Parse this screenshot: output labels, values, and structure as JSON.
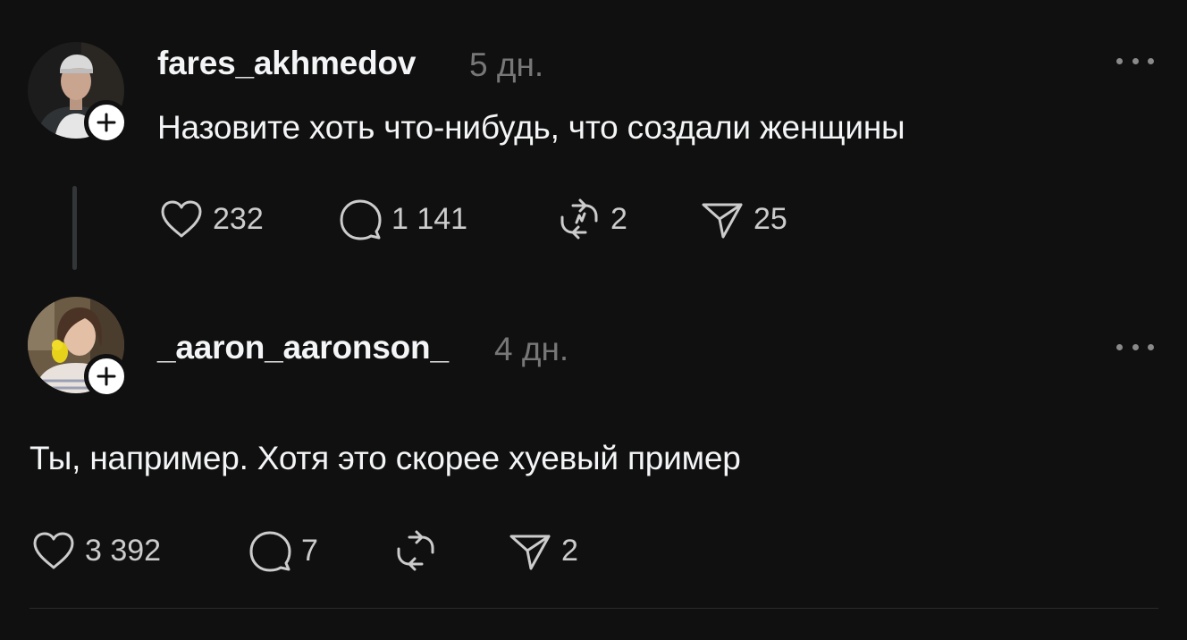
{
  "posts": [
    {
      "username": "fares_akhmedov",
      "time": "5 дн.",
      "text": "Назовите хоть что-нибудь, что создали женщины",
      "likes": "232",
      "replies": "1 141",
      "reposts": "2",
      "shares": "25"
    },
    {
      "username": "_aaron_aaronson_",
      "time": "4 дн.",
      "text": "Ты, например. Хотя это скорее хуевый пример",
      "likes": "3 392",
      "replies": "7",
      "reposts": "",
      "shares": "2"
    }
  ],
  "icons": {
    "like": "heart-icon",
    "reply": "comment-icon",
    "repost": "repost-icon",
    "share": "send-icon",
    "follow": "plus-icon",
    "more": "more-horizontal-icon"
  },
  "colors": {
    "background": "#101010",
    "primary_text": "#f3f5f7",
    "secondary_text": "#777777",
    "icon": "#cccccc",
    "thread_line": "#333638"
  }
}
